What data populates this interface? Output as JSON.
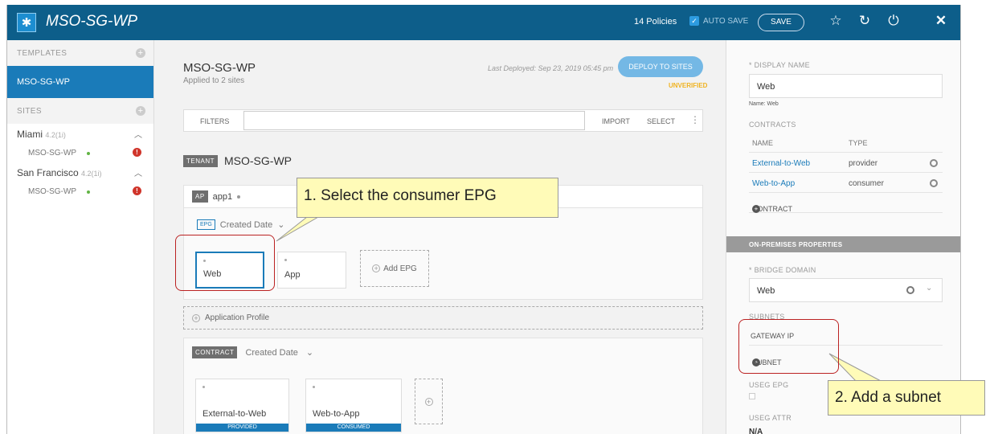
{
  "topbar": {
    "title": "MSO-SG-WP",
    "policies": "14 Policies",
    "autosave": "AUTO SAVE",
    "save": "SAVE",
    "icons": [
      "star-icon",
      "refresh-icon",
      "power-icon",
      "close-icon"
    ]
  },
  "sidebar": {
    "templates_header": "TEMPLATES",
    "active_template": "MSO-SG-WP",
    "sites_header": "SITES",
    "sites": [
      {
        "name": "Miami",
        "version": "4.2(1i)",
        "template": "MSO-SG-WP"
      },
      {
        "name": "San Francisco",
        "version": "4.2(1i)",
        "template": "MSO-SG-WP"
      }
    ]
  },
  "main": {
    "title": "MSO-SG-WP",
    "subtitle": "Applied to 2 sites",
    "last_deployed": "Last Deployed: Sep 23, 2019 05:45 pm",
    "deploy_button": "DEPLOY TO SITES",
    "status": "UNVERIFIED",
    "filters_label": "FILTERS",
    "import": "IMPORT",
    "select": "SELECT",
    "tenant_tag": "TENANT",
    "tenant_name": "MSO-SG-WP",
    "ap_tag": "AP",
    "ap_name": "app1",
    "epg_tag": "EPG",
    "epg_sort": "Created Date",
    "epgs": [
      "Web",
      "App"
    ],
    "add_epg": "Add EPG",
    "application_profile": "Application Profile",
    "contract_tag": "CONTRACT",
    "contract_sort": "Created Date",
    "contracts": [
      {
        "name": "External-to-Web",
        "badge": "PROVIDED"
      },
      {
        "name": "Web-to-App",
        "badge": "CONSUMED"
      }
    ]
  },
  "right": {
    "display_name_label": "* DISPLAY NAME",
    "display_name_value": "Web",
    "name_hint": "Name: Web",
    "contracts_label": "CONTRACTS",
    "col_name": "NAME",
    "col_type": "TYPE",
    "contracts": [
      {
        "name": "External-to-Web",
        "type": "provider"
      },
      {
        "name": "Web-to-App",
        "type": "consumer"
      }
    ],
    "add_contract": "CONTRACT",
    "onprem_header": "ON-PREMISES PROPERTIES",
    "bridge_domain_label": "* BRIDGE DOMAIN",
    "bridge_domain_value": "Web",
    "subnets_label": "SUBNETS",
    "gateway_ip": "GATEWAY IP",
    "add_subnet": "SUBNET",
    "useg_epg": "USEG EPG",
    "useg_attr": "USEG ATTR",
    "useg_attr_value": "N/A"
  },
  "callouts": {
    "one": "1. Select the consumer EPG",
    "two": "2. Add a subnet"
  },
  "colors": {
    "topbar": "#0d5e8a",
    "accent": "#1a7bb9",
    "warning": "#f0b322",
    "callout": "#fffbb8"
  }
}
